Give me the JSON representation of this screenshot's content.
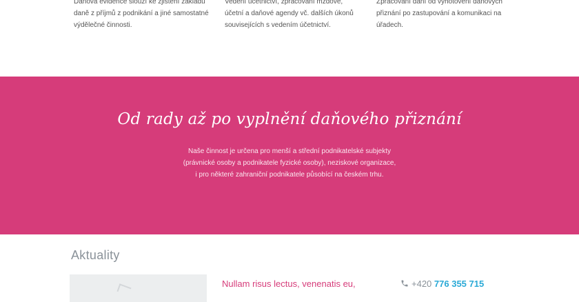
{
  "services": [
    {
      "text": "Daňová evidence slouží ke zjištění základu daně z příjmů z podnikání a jiné samostatné výdělečné činnosti."
    },
    {
      "text": "Vedení účetnictví, zpracování mzdové, účetní a daňové agendy vč. dalších úkonů souvisejících s vedením účetnictví."
    },
    {
      "text": "Zpracování daní od vyhotovení daňových přiznání po zastupování a komunikaci na úřadech."
    }
  ],
  "banner": {
    "title": "Od rady až po vyplnění daňového přiznání",
    "lines": [
      "Naše činnost je určena pro menší a střední podnikatelské subjekty",
      "(právnické osoby a podnikatele fyzické osoby), neziskové organizace,",
      "i pro některé zahraniční podnikatele působící na českém trhu."
    ],
    "color": "#d63c7a"
  },
  "news": {
    "heading": "Aktuality",
    "article_title": "Nullam risus lectus, venenatis eu,"
  },
  "contact": {
    "prefix": "+420",
    "number": "776 355 715",
    "icon": "phone-icon"
  }
}
